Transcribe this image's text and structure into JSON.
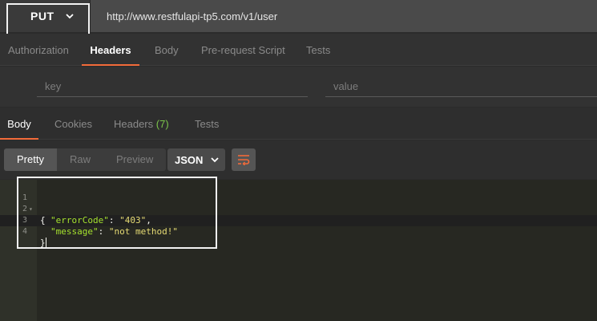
{
  "request": {
    "method": "PUT",
    "url": "http://www.restfulapi-tp5.com/v1/user"
  },
  "request_tabs": [
    {
      "label": "Authorization",
      "active": false
    },
    {
      "label": "Headers",
      "active": true
    },
    {
      "label": "Body",
      "active": false
    },
    {
      "label": "Pre-request Script",
      "active": false
    },
    {
      "label": "Tests",
      "active": false
    }
  ],
  "header_editor": {
    "key_placeholder": "key",
    "value_placeholder": "value"
  },
  "response_tabs": [
    {
      "label": "Body",
      "active": true
    },
    {
      "label": "Cookies",
      "active": false
    },
    {
      "label": "Headers",
      "count": "(7)",
      "active": false
    },
    {
      "label": "Tests",
      "active": false
    }
  ],
  "view_modes": [
    {
      "label": "Pretty",
      "active": true
    },
    {
      "label": "Raw",
      "active": false
    },
    {
      "label": "Preview",
      "active": false
    }
  ],
  "format": "JSON",
  "response_body": {
    "line_numbers": [
      "1",
      "2",
      "3",
      "4"
    ],
    "open_brace": "{",
    "close_brace": "}",
    "fields": [
      {
        "key": "\"errorCode\"",
        "value": "\"403\"",
        "trail": ","
      },
      {
        "key": "\"message\"",
        "value": "\"not method!\"",
        "trail": ""
      }
    ]
  },
  "colors": {
    "accent": "#f26b3a",
    "count": "#7bc44a",
    "json_key": "#a6e22e",
    "json_string": "#e6db74"
  },
  "icons": {
    "method_dropdown": "chevron-down-icon",
    "format_dropdown": "chevron-down-icon",
    "wrap": "wrap-lines-icon",
    "fold": "fold-arrow-icon"
  }
}
